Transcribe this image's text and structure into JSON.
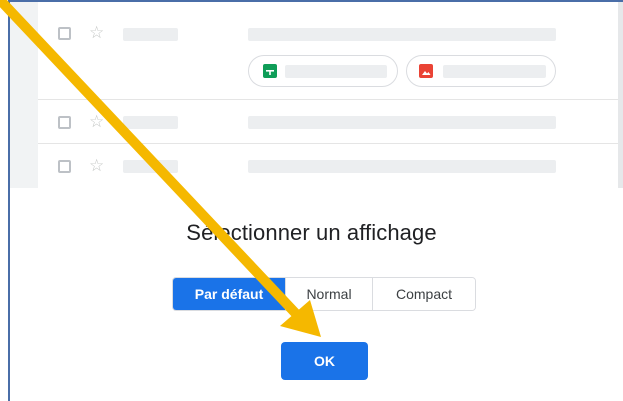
{
  "dialog": {
    "title": "Sélectionner un affichage",
    "density_options": [
      "Par défaut",
      "Normal",
      "Compact"
    ],
    "selected_option": "Par défaut",
    "ok_label": "OK"
  },
  "colors": {
    "accent": "#1a73e8",
    "annotation_arrow": "#f5b800",
    "sheets_icon": "#0f9d58",
    "image_icon": "#ea4335"
  },
  "icons": [
    "checkbox-icon",
    "star-icon",
    "sheets-file-icon",
    "image-file-icon",
    "annotation-arrow-icon"
  ]
}
